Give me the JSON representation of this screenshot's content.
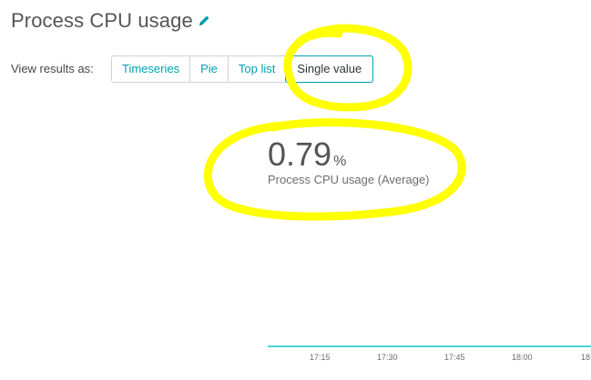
{
  "header": {
    "title": "Process CPU usage",
    "edit_icon": "pencil-icon",
    "accent_color": "#00a1b2"
  },
  "view_results": {
    "label": "View results as:",
    "options": [
      "Timeseries",
      "Pie",
      "Top list",
      "Single value"
    ],
    "selected": "Single value"
  },
  "single_value": {
    "value": "0.79",
    "unit": "%",
    "caption": "Process CPU usage (Average)"
  },
  "timeline": {
    "ticks": [
      "17:15",
      "17:30",
      "17:45",
      "18:00",
      "18"
    ],
    "line_color": "#4fd1d9"
  },
  "annotation": {
    "highlight_color": "#ffff00"
  }
}
